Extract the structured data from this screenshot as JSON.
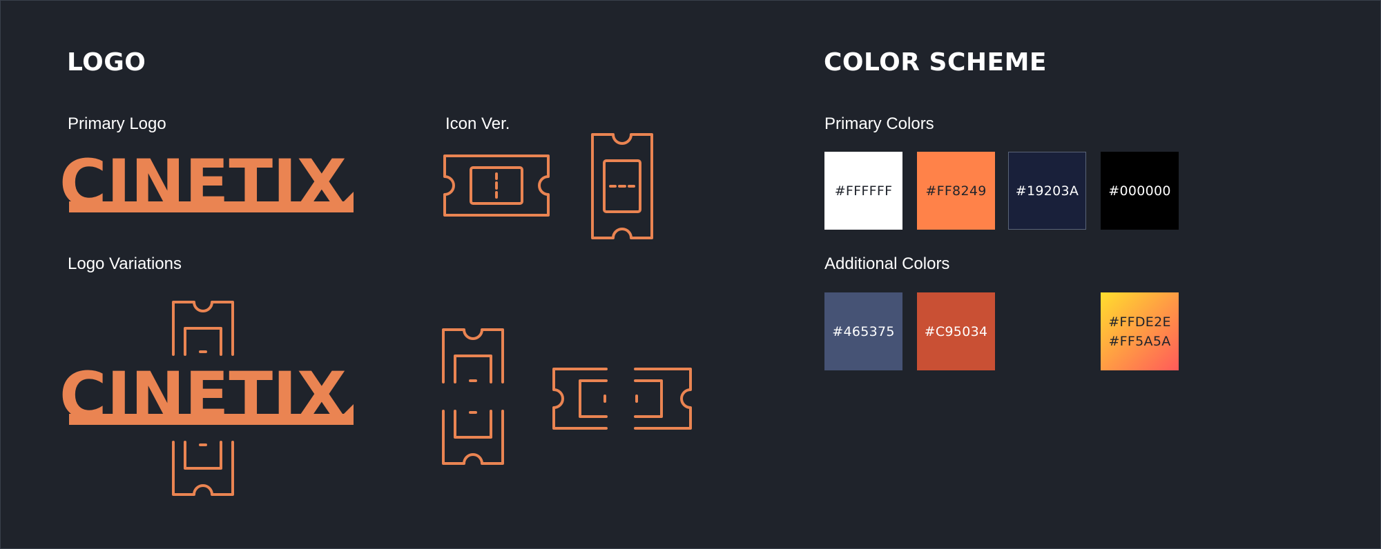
{
  "logo_section": {
    "heading": "LOGO",
    "primary_logo_label": "Primary Logo",
    "icon_label": "Icon Ver.",
    "variations_label": "Logo Variations",
    "wordmark": "CINETIX",
    "logo_color": "#EA8452",
    "icons": [
      "ticket-horizontal-icon",
      "ticket-vertical-icon",
      "ticket-top-half-icon",
      "ticket-bottom-half-icon",
      "ticket-left-half-icon",
      "ticket-right-half-icon"
    ]
  },
  "color_section": {
    "heading": "COLOR SCHEME",
    "primary_label": "Primary Colors",
    "additional_label": "Additional Colors",
    "primary_colors": [
      {
        "label": "#FFFFFF",
        "color": "#FFFFFF",
        "text_color": "#1F232B"
      },
      {
        "label": "#FF8249",
        "color": "#FF8249",
        "text_color": "#1F232B"
      },
      {
        "label": "#19203A",
        "color": "#19203A",
        "text_color": "#FFFFFF"
      },
      {
        "label": "#000000",
        "color": "#000000",
        "text_color": "#FFFFFF"
      }
    ],
    "additional_colors": [
      {
        "label": "#465375",
        "color": "#465375",
        "text_color": "#FFFFFF"
      },
      {
        "label": "#C95034",
        "color": "#C95034",
        "text_color": "#FFFFFF"
      },
      {
        "label": "#FFDE2E\n#FF5A5A",
        "gradient": [
          "#FFDE2E",
          "#FF5A5A"
        ],
        "text_color": "#1F232B"
      }
    ]
  }
}
